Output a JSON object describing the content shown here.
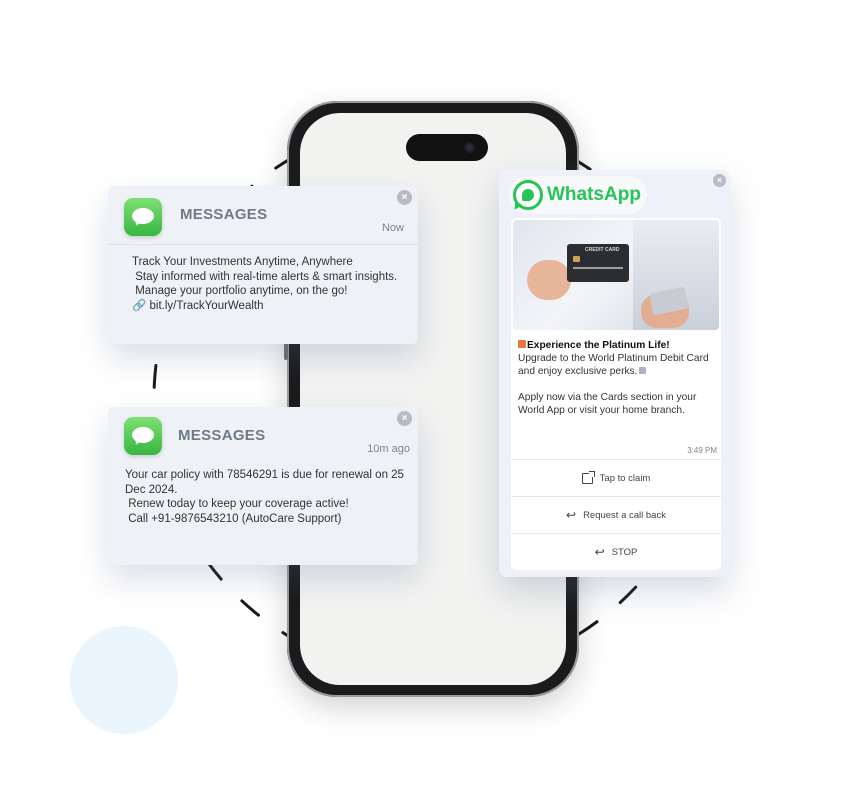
{
  "messages_cards": [
    {
      "app_name": "MESSAGES",
      "time": "Now",
      "close_label": "×",
      "lines": [
        "Track Your Investments Anytime, Anywhere",
        " Stay informed with real-time alerts & smart insights.",
        " Manage your portfolio anytime, on the go!",
        "🔗 bit.ly/TrackYourWealth"
      ]
    },
    {
      "app_name": "MESSAGES",
      "time": "10m ago",
      "close_label": "×",
      "lines": [
        "Your car policy with 78546291 is due for renewal on 25 Dec 2024.",
        "",
        " Renew today to keep your coverage active!",
        "",
        " Call +91-9876543210 (AutoCare Support)"
      ]
    }
  ],
  "whatsapp": {
    "brand": "WhatsApp",
    "close_label": "×",
    "card_label": "CREDIT CARD",
    "headline": "Experience the Platinum Life!",
    "body_1": " Upgrade to the World Platinum Debit Card and enjoy exclusive perks.",
    "body_2": "Apply now via the Cards section in your World App or visit your home branch.",
    "time": "3:49 PM",
    "actions": [
      {
        "label": "Tap to claim",
        "icon": "external-link-icon"
      },
      {
        "label": "Request a call back",
        "icon": "reply-icon"
      },
      {
        "label": "STOP",
        "icon": "reply-icon"
      }
    ]
  },
  "colors": {
    "whatsapp_green": "#27c457",
    "messages_green": "#37b542",
    "card_bg": "#eef1f6"
  }
}
